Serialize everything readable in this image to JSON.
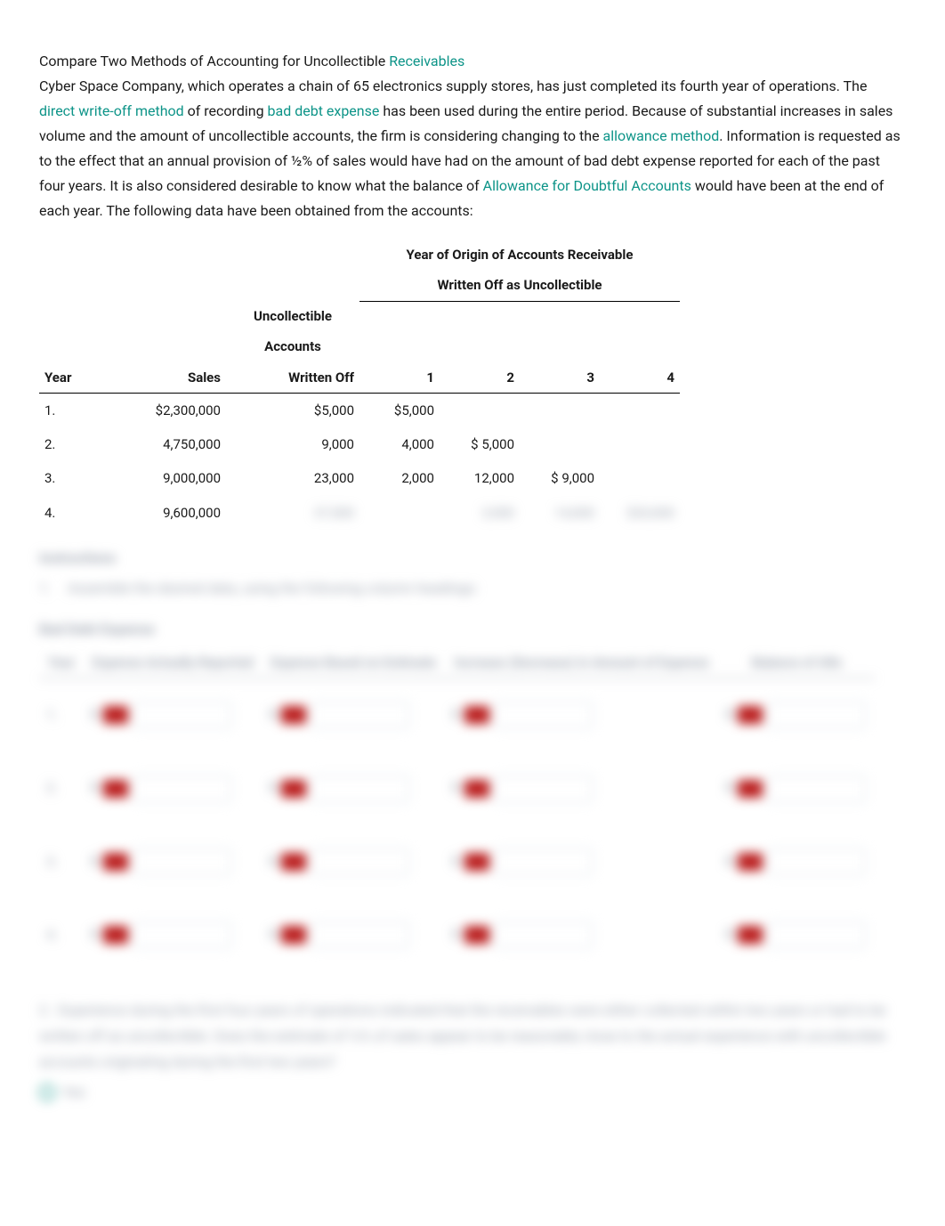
{
  "intro": {
    "title_prefix": "Compare Two Methods of Accounting for Uncollectible ",
    "title_link": "Receivables",
    "p1_a": "Cyber Space Company, which operates a chain of 65 electronics supply stores, has just completed its fourth year of operations. The ",
    "link_dw": "direct write-off method",
    "p1_b": " of recording ",
    "link_bde": "bad debt expense",
    "p1_c": " has been used during the entire period. Because of substantial increases in sales volume and the amount of uncollectible accounts, the firm is considering changing to the ",
    "link_am": "allowance method",
    "p1_d": ". Information is requested as to the effect that an annual provision of ½% of sales would have had on the amount of bad debt expense reported for each of the past four years. It is also considered desirable to know what the balance of ",
    "link_ada": "Allowance for Doubtful Accounts",
    "p1_e": " would have been at the end of each year. The following data have been obtained from the accounts:"
  },
  "table1": {
    "spanhead_a": "Year of Origin of Accounts Receivable",
    "spanhead_b": "Written Off as Uncollectible",
    "h_year": "Year",
    "h_sales": "Sales",
    "h_unc_a": "Uncollectible",
    "h_unc_b": "Accounts",
    "h_unc_c": "Written Off",
    "h_y1": "1",
    "h_y2": "2",
    "h_y3": "3",
    "h_y4": "4",
    "rows": [
      {
        "year": "1.",
        "sales": "$2,300,000",
        "unc": "$5,000",
        "y1": "$5,000",
        "y2": "",
        "y3": "",
        "y4": ""
      },
      {
        "year": "2.",
        "sales": "4,750,000",
        "unc": "9,000",
        "y1": "4,000",
        "y2": "$ 5,000",
        "y3": "",
        "y4": ""
      },
      {
        "year": "3.",
        "sales": "9,000,000",
        "unc": "23,000",
        "y1": "2,000",
        "y2": "12,000",
        "y3": "$ 9,000",
        "y4": ""
      },
      {
        "year": "4.",
        "sales": "9,600,000",
        "unc": "37,500",
        "y1": "",
        "y2": "3,500",
        "y3": "14,000",
        "y4": "$20,000"
      }
    ]
  },
  "blurred": {
    "inst_label": "Instructions",
    "inst1_num": "1.",
    "inst1_text": "Assemble the desired data, using the following column headings:",
    "bad_debt_title": "Bad Debt Expense",
    "ans_headers": {
      "year": "Year",
      "actual": "Expense Actually Reported",
      "based": "Expense Based on Estimate",
      "incdec": "Increase (Decrease) in Amount of Expense",
      "balance": "Balance of Allo"
    },
    "ans_years": [
      "1.",
      "2.",
      "3.",
      "4."
    ],
    "blank": "—",
    "q2_num": "2.",
    "q2_text": "Experience during the first four years of operations indicated that the receivables were either collected within two years or had to be written off as uncollectible. Does the estimate of ½% of sales appear to be reasonably close to the actual experience with uncollectible accounts originating during the first two years?",
    "q2_opt": "Yes"
  }
}
